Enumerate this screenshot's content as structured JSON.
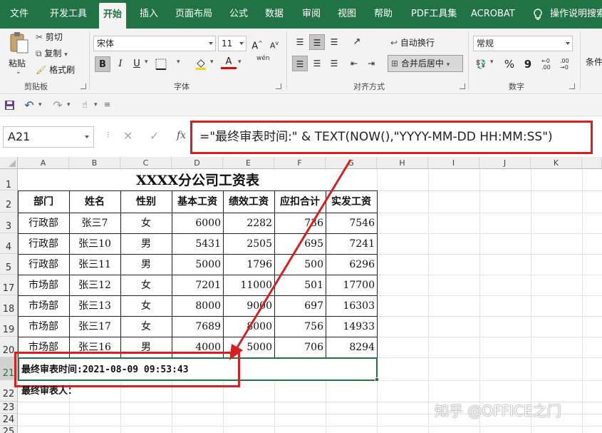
{
  "ribbon_tabs": [
    "文件",
    "开发工具",
    "开始",
    "插入",
    "页面布局",
    "公式",
    "数据",
    "审阅",
    "视图",
    "帮助",
    "PDF工具集",
    "ACROBAT",
    "操作说明搜索"
  ],
  "active_tab": "开始",
  "clipboard": {
    "paste": "粘贴",
    "cut": "剪切",
    "copy": "复制",
    "format_painter": "格式刷",
    "group": "剪贴板"
  },
  "font": {
    "name": "宋体",
    "size": "11",
    "grow": "A",
    "shrink": "A",
    "bold": "B",
    "italic": "I",
    "underline": "U",
    "font_color": "A",
    "phonetic": "wén",
    "group": "字体"
  },
  "alignment": {
    "wrap": "自动换行",
    "merge": "合并后居中",
    "group": "对齐方式"
  },
  "number": {
    "format": "常规",
    "percent": "%",
    "comma": "9",
    "inc_decimal": ".00",
    "dec_decimal": ".00",
    "group": "数字"
  },
  "styles": {
    "conditional": "条件"
  },
  "formula_bar": {
    "name_box": "A21",
    "fx": "fx",
    "formula": "=\"最终审表时间:\" & TEXT(NOW(),\"YYYY-MM-DD HH:MM:SS\")"
  },
  "columns": [
    "A",
    "B",
    "C",
    "D",
    "E",
    "F",
    "G",
    "H",
    "I",
    "J",
    "K"
  ],
  "rows": [
    "1",
    "2",
    "3",
    "4",
    "5",
    "17",
    "18",
    "19",
    "20",
    "21",
    "22",
    "23",
    "24",
    "25"
  ],
  "table": {
    "title": "XXXX分公司工资表",
    "headers": [
      "部门",
      "姓名",
      "性别",
      "基本工资",
      "绩效工资",
      "应扣合计",
      "实发工资"
    ],
    "rows": [
      [
        "行政部",
        "张三7",
        "女",
        "6000",
        "2282",
        "736",
        "7546"
      ],
      [
        "行政部",
        "张三10",
        "男",
        "5431",
        "2505",
        "695",
        "7241"
      ],
      [
        "行政部",
        "张三11",
        "男",
        "5000",
        "1796",
        "500",
        "6296"
      ],
      [
        "市场部",
        "张三12",
        "女",
        "7201",
        "11000",
        "501",
        "17700"
      ],
      [
        "市场部",
        "张三13",
        "女",
        "8000",
        "9000",
        "697",
        "16303"
      ],
      [
        "市场部",
        "张三17",
        "女",
        "7689",
        "8000",
        "756",
        "14933"
      ],
      [
        "市场部",
        "张三16",
        "男",
        "4000",
        "5000",
        "706",
        "8294"
      ]
    ],
    "a21": "最终审表时间:2021-08-09 09:53:43",
    "a22": "最终审表人："
  },
  "watermark": "知乎 @OFFICE之门",
  "colors": {
    "excel_green": "#217346",
    "annotation_red": "#d62020"
  }
}
